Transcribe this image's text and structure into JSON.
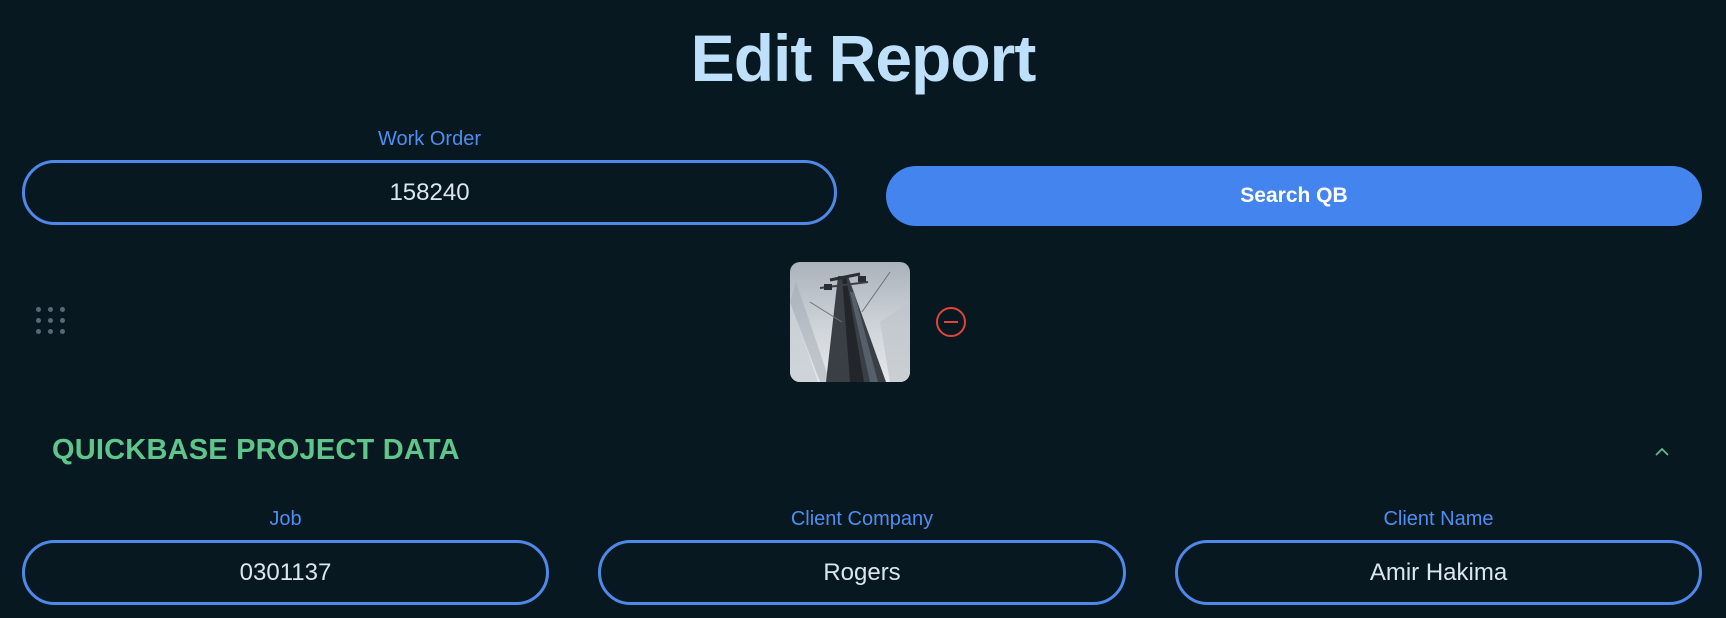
{
  "page": {
    "title": "Edit Report"
  },
  "work_order": {
    "label": "Work Order",
    "value": "158240"
  },
  "search_button": {
    "label": "Search QB",
    "color": "#4384ee"
  },
  "photo": {
    "icon": "photo-thumbnail",
    "remove_icon": "remove-circle-icon",
    "drag_icon": "drag-handle-icon"
  },
  "section": {
    "title": "QUICKBASE PROJECT DATA",
    "collapse_icon": "chevron-up-icon",
    "color": "#5fc58a"
  },
  "fields": {
    "job": {
      "label": "Job",
      "value": "0301137"
    },
    "client_company": {
      "label": "Client Company",
      "value": "Rogers"
    },
    "client_name": {
      "label": "Client Name",
      "value": "Amir Hakima"
    }
  },
  "colors": {
    "background": "#071820",
    "title": "#bfe0fb",
    "label": "#4f8ef0",
    "field_border": "#4f88e8",
    "remove": "#e0443a"
  }
}
